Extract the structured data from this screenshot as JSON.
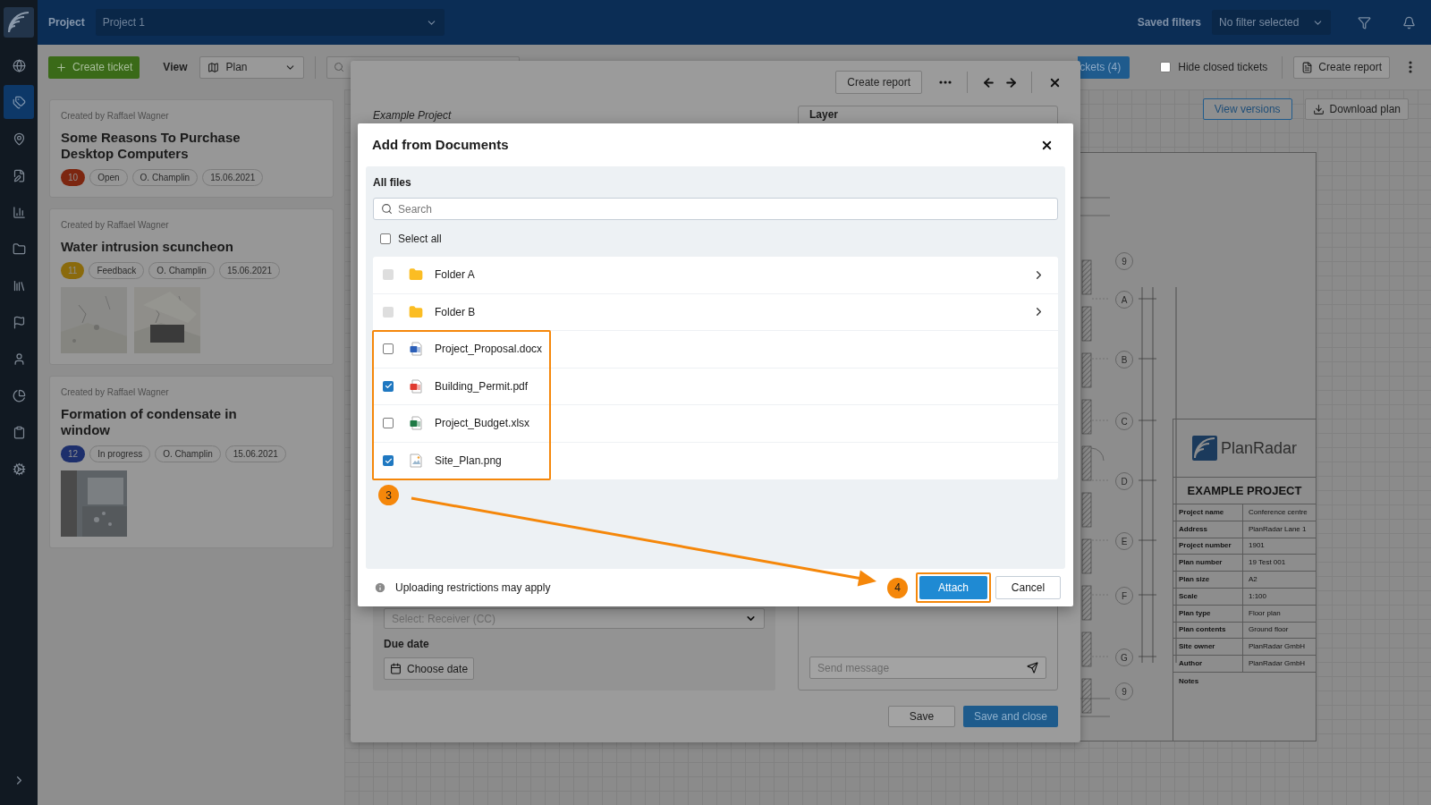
{
  "sidebar": {
    "items": [
      {
        "selected": false
      },
      {
        "selected": true
      },
      {
        "selected": false
      },
      {
        "selected": false
      },
      {
        "selected": false
      },
      {
        "selected": false
      },
      {
        "selected": false
      },
      {
        "selected": false
      },
      {
        "selected": false
      },
      {
        "selected": false
      },
      {
        "selected": false
      },
      {
        "selected": false
      }
    ]
  },
  "top_bar": {
    "section_label": "Project",
    "project_select": "Project 1",
    "saved_filters_label": "Saved filters",
    "filter_select": "No filter selected"
  },
  "toolbar": {
    "create_ticket": "Create ticket",
    "view_label": "View",
    "view_select": "Plan",
    "tickets_button": "ckets (4)",
    "hide_closed": {
      "label": "Hide closed tickets",
      "checked": false
    },
    "create_report": "Create report"
  },
  "tickets": [
    {
      "created_by": "Created by Raffael Wagner",
      "title": "Some Reasons To Purchase Desktop Computers",
      "number": "10",
      "color": "#7c2610",
      "status": "Open",
      "assignee": "O. Champlin",
      "date": "15.06.2021"
    },
    {
      "created_by": "Created by Raffael Wagner",
      "title": "Water intrusion scuncheon",
      "number": "11",
      "color": "#8a6a0c",
      "status": "Feedback",
      "assignee": "O. Champlin",
      "date": "15.06.2021"
    },
    {
      "created_by": "Created by Raffael Wagner",
      "title": "Formation of condensate in window",
      "number": "12",
      "color": "#1d2f6c",
      "status": "In progress",
      "assignee": "O. Champlin",
      "date": "15.06.2021"
    }
  ],
  "plan": {
    "view_versions": "View versions",
    "download_plan": "Download plan",
    "axis_labels": [
      "9",
      "A",
      "B",
      "C",
      "D",
      "E",
      "F",
      "G",
      "9"
    ],
    "title_block": {
      "brand": "PlanRadar",
      "title": "EXAMPLE PROJECT",
      "rows": [
        {
          "label": "Project name",
          "value": "Conference centre"
        },
        {
          "label": "Address",
          "value": "PlanRadar Lane 1"
        },
        {
          "label": "Project number",
          "value": "1901"
        },
        {
          "label": "Plan number",
          "value": "19 Test 001"
        },
        {
          "label": "Plan size",
          "value": "A2"
        },
        {
          "label": "Scale",
          "value": "1:100"
        },
        {
          "label": "Plan type",
          "value": "Floor plan"
        },
        {
          "label": "Plan contents",
          "value": "Ground floor"
        },
        {
          "label": "Site owner",
          "value": "PlanRadar GmbH"
        },
        {
          "label": "Author",
          "value": "PlanRadar GmbH"
        }
      ],
      "notes_label": "Notes"
    }
  },
  "ticket_modal": {
    "create_report": "Create report",
    "project": "Example Project",
    "layer_label": "Layer",
    "receiver_placeholder": "Select: Receiver (CC)",
    "due_date_label": "Due date",
    "choose_date": "Choose date",
    "message_placeholder": "Send message",
    "save": "Save",
    "save_and_close": "Save and close"
  },
  "documents_dialog": {
    "title": "Add from Documents",
    "section": "All files",
    "search_placeholder": "Search",
    "select_all": {
      "label": "Select all",
      "checked": false
    },
    "items": [
      {
        "kind": "folder",
        "name": "Folder A",
        "checked": false,
        "disabled": true
      },
      {
        "kind": "folder",
        "name": "Folder B",
        "checked": false,
        "disabled": true
      },
      {
        "kind": "docx",
        "name": "Project_Proposal.docx",
        "checked": false,
        "disabled": false
      },
      {
        "kind": "pdf",
        "name": "Building_Permit.pdf",
        "checked": true,
        "disabled": false
      },
      {
        "kind": "xlsx",
        "name": "Project_Budget.xlsx",
        "checked": false,
        "disabled": false
      },
      {
        "kind": "png",
        "name": "Site_Plan.png",
        "checked": true,
        "disabled": false
      }
    ],
    "note": "Uploading restrictions may apply",
    "attach": "Attach",
    "cancel": "Cancel"
  },
  "step_markers": [
    {
      "label": "3"
    },
    {
      "label": "4"
    }
  ]
}
